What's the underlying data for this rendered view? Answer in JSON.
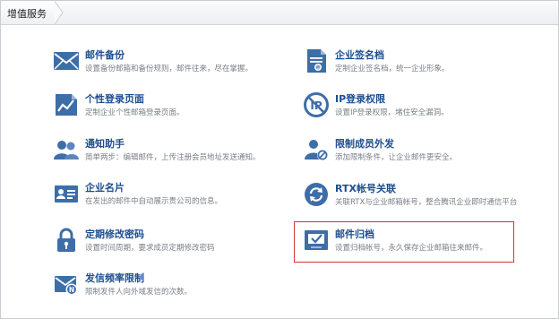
{
  "header": {
    "title": "增值服务"
  },
  "services": {
    "left": [
      {
        "title": "邮件备份",
        "desc": "设置备份邮箱和备份规则，邮件往来，尽在掌握。",
        "icon": "envelope-icon"
      },
      {
        "title": "个性登录页面",
        "desc": "定制企业个性邮箱登录页面。",
        "icon": "login-page-chart-icon"
      },
      {
        "title": "通知助手",
        "desc": "简单两步：编辑邮件，上传注册会员地址发送通知。",
        "icon": "users-icon"
      },
      {
        "title": "企业名片",
        "desc": "在发出的邮件中自动展示贵公司的信息。",
        "icon": "business-card-icon"
      },
      {
        "title": "定期修改密码",
        "desc": "设置时间周期，要求成员定期修改密码",
        "icon": "lock-icon"
      },
      {
        "title": "发信频率限制",
        "desc": "限制发件人向外域发信的次数。",
        "icon": "mail-limit-icon"
      }
    ],
    "right": [
      {
        "title": "企业签名档",
        "desc": "定制企业签名档，统一企业形象。",
        "icon": "signature-document-icon"
      },
      {
        "title": "IP登录权限",
        "desc": "设置IP登录权限，堵住安全漏洞。",
        "icon": "ip-restriction-icon"
      },
      {
        "title": "限制成员外发",
        "desc": "添加限制条件，让企业邮件更安全。",
        "icon": "restrict-member-icon"
      },
      {
        "title": "RTX帐号关联",
        "desc": "关联RTX与企业邮箱帐号，整合腾讯企业即时通信平台",
        "icon": "rtx-sync-icon"
      },
      {
        "title": "邮件归档",
        "desc": "设置归档帐号，永久保存企业邮箱往来邮件。",
        "icon": "mail-archive-icon"
      }
    ]
  }
}
